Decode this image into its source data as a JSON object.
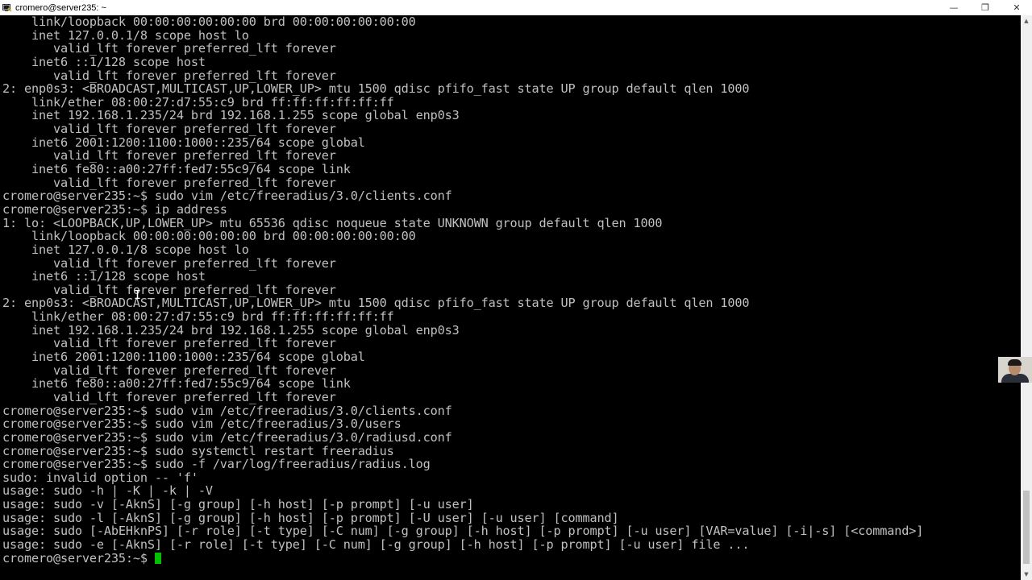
{
  "window": {
    "title": "cromero@server235: ~",
    "controls": {
      "minimize": "—",
      "restore": "❐",
      "close": "✕"
    }
  },
  "terminal": {
    "cursor_color": "#00c000",
    "text_color": "#c0c0c0",
    "background": "#000000",
    "lines": [
      "    link/loopback 00:00:00:00:00:00 brd 00:00:00:00:00:00",
      "    inet 127.0.0.1/8 scope host lo",
      "       valid_lft forever preferred_lft forever",
      "    inet6 ::1/128 scope host",
      "       valid_lft forever preferred_lft forever",
      "2: enp0s3: <BROADCAST,MULTICAST,UP,LOWER_UP> mtu 1500 qdisc pfifo_fast state UP group default qlen 1000",
      "    link/ether 08:00:27:d7:55:c9 brd ff:ff:ff:ff:ff:ff",
      "    inet 192.168.1.235/24 brd 192.168.1.255 scope global enp0s3",
      "       valid_lft forever preferred_lft forever",
      "    inet6 2001:1200:1100:1000::235/64 scope global",
      "       valid_lft forever preferred_lft forever",
      "    inet6 fe80::a00:27ff:fed7:55c9/64 scope link",
      "       valid_lft forever preferred_lft forever",
      "cromero@server235:~$ sudo vim /etc/freeradius/3.0/clients.conf",
      "cromero@server235:~$ ip address",
      "1: lo: <LOOPBACK,UP,LOWER_UP> mtu 65536 qdisc noqueue state UNKNOWN group default qlen 1000",
      "    link/loopback 00:00:00:00:00:00 brd 00:00:00:00:00:00",
      "    inet 127.0.0.1/8 scope host lo",
      "       valid_lft forever preferred_lft forever",
      "    inet6 ::1/128 scope host",
      "       valid_lft forever preferred_lft forever",
      "2: enp0s3: <BROADCAST,MULTICAST,UP,LOWER_UP> mtu 1500 qdisc pfifo_fast state UP group default qlen 1000",
      "    link/ether 08:00:27:d7:55:c9 brd ff:ff:ff:ff:ff:ff",
      "    inet 192.168.1.235/24 brd 192.168.1.255 scope global enp0s3",
      "       valid_lft forever preferred_lft forever",
      "    inet6 2001:1200:1100:1000::235/64 scope global",
      "       valid_lft forever preferred_lft forever",
      "    inet6 fe80::a00:27ff:fed7:55c9/64 scope link",
      "       valid_lft forever preferred_lft forever",
      "cromero@server235:~$ sudo vim /etc/freeradius/3.0/clients.conf",
      "cromero@server235:~$ sudo vim /etc/freeradius/3.0/users",
      "cromero@server235:~$ sudo vim /etc/freeradius/3.0/radiusd.conf",
      "cromero@server235:~$ sudo systemctl restart freeradius",
      "cromero@server235:~$ sudo -f /var/log/freeradius/radius.log",
      "sudo: invalid option -- 'f'",
      "usage: sudo -h | -K | -k | -V",
      "usage: sudo -v [-AknS] [-g group] [-h host] [-p prompt] [-u user]",
      "usage: sudo -l [-AknS] [-g group] [-h host] [-p prompt] [-U user] [-u user] [command]",
      "usage: sudo [-AbEHknPS] [-r role] [-t type] [-C num] [-g group] [-h host] [-p prompt] [-u user] [VAR=value] [-i|-s] [<command>]",
      "usage: sudo -e [-AknS] [-r role] [-t type] [-C num] [-g group] [-h host] [-p prompt] [-u user] file ..."
    ],
    "prompt": "cromero@server235:~$ "
  },
  "scrollbar": {
    "up_arrow": "▲",
    "down_arrow": "▼"
  }
}
